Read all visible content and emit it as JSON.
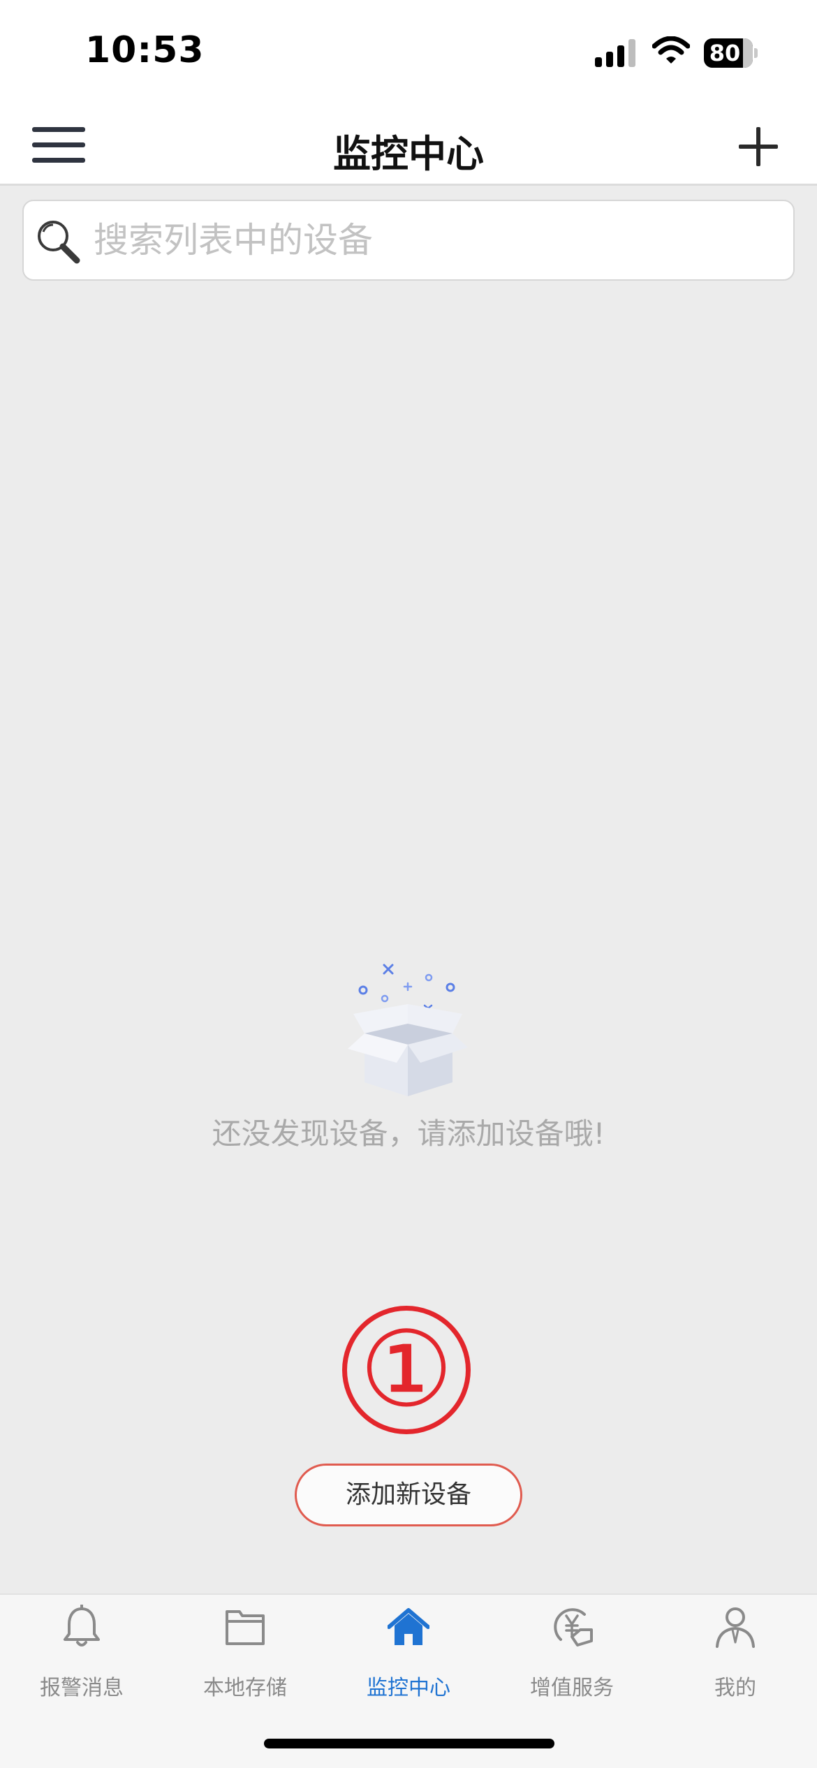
{
  "status_bar": {
    "time": "10:53",
    "battery_level": "80",
    "signal_icon": "cellular-signal-icon",
    "wifi_icon": "wifi-icon",
    "battery_icon": "battery-icon"
  },
  "nav": {
    "title": "监控中心",
    "menu_icon": "hamburger-menu-icon",
    "add_icon": "plus-icon"
  },
  "search": {
    "placeholder": "搜索列表中的设备",
    "value": ""
  },
  "empty_state": {
    "illustration": "empty-box-icon",
    "message": "还没发现设备，请添加设备哦!"
  },
  "step_marker": "①",
  "add_device_button": "添加新设备",
  "tabs": [
    {
      "label": "报警消息",
      "icon": "bell-icon",
      "active": false
    },
    {
      "label": "本地存储",
      "icon": "folder-icon",
      "active": false
    },
    {
      "label": "监控中心",
      "icon": "home-icon",
      "active": true
    },
    {
      "label": "增值服务",
      "icon": "yen-service-icon",
      "active": false
    },
    {
      "label": "我的",
      "icon": "user-icon",
      "active": false
    }
  ],
  "colors": {
    "accent": "#1f73d2",
    "step_marker": "#e3262c",
    "button_border": "#e05b4f",
    "background": "#ececec"
  }
}
